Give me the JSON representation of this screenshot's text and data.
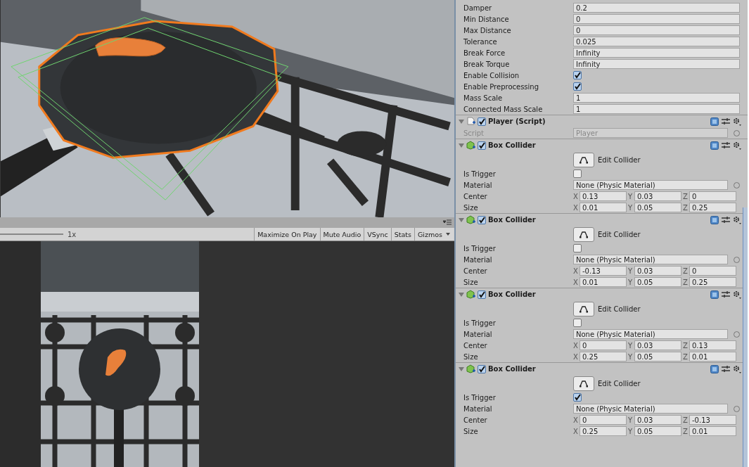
{
  "game_toolbar": {
    "scale_label": "1x",
    "buttons": [
      {
        "label": "Maximize On Play",
        "kind": "toggle"
      },
      {
        "label": "Mute Audio",
        "kind": "toggle"
      },
      {
        "label": "VSync",
        "kind": "toggle"
      },
      {
        "label": "Stats",
        "kind": "toggle"
      },
      {
        "label": "Gizmos",
        "kind": "dropdown"
      }
    ]
  },
  "inspector": {
    "joint_fields": [
      {
        "label": "Damper",
        "kind": "text",
        "value": "0.2"
      },
      {
        "label": "Min Distance",
        "kind": "text",
        "value": "0"
      },
      {
        "label": "Max Distance",
        "kind": "text",
        "value": "0"
      },
      {
        "label": "Tolerance",
        "kind": "text",
        "value": "0.025"
      },
      {
        "label": "Break Force",
        "kind": "text",
        "value": "Infinity"
      },
      {
        "label": "Break Torque",
        "kind": "text",
        "value": "Infinity"
      },
      {
        "label": "Enable Collision",
        "kind": "checkbox",
        "checked": true
      },
      {
        "label": "Enable Preprocessing",
        "kind": "checkbox",
        "checked": true
      },
      {
        "label": "Mass Scale",
        "kind": "text",
        "value": "1"
      },
      {
        "label": "Connected Mass Scale",
        "kind": "text",
        "value": "1"
      }
    ],
    "components": [
      {
        "kind": "script",
        "title": "Player (Script)",
        "enabled": true,
        "fields": [
          {
            "label": "Script",
            "kind": "object",
            "value": "Player",
            "disabled": true
          }
        ]
      },
      {
        "kind": "collider",
        "title": "Box Collider",
        "enabled": true,
        "button": "Edit Collider",
        "fields": [
          {
            "label": "Is Trigger",
            "kind": "checkbox",
            "checked": false
          },
          {
            "label": "Material",
            "kind": "object",
            "value": "None (Physic Material)",
            "disabled": false
          },
          {
            "label": "Center",
            "kind": "vector3",
            "axes": [
              {
                "axis": "X",
                "value": "0.13"
              },
              {
                "axis": "Y",
                "value": "0.03"
              },
              {
                "axis": "Z",
                "value": "0"
              }
            ]
          },
          {
            "label": "Size",
            "kind": "vector3",
            "axes": [
              {
                "axis": "X",
                "value": "0.01"
              },
              {
                "axis": "Y",
                "value": "0.05"
              },
              {
                "axis": "Z",
                "value": "0.25"
              }
            ]
          }
        ]
      },
      {
        "kind": "collider",
        "title": "Box Collider",
        "enabled": true,
        "button": "Edit Collider",
        "fields": [
          {
            "label": "Is Trigger",
            "kind": "checkbox",
            "checked": false
          },
          {
            "label": "Material",
            "kind": "object",
            "value": "None (Physic Material)",
            "disabled": false
          },
          {
            "label": "Center",
            "kind": "vector3",
            "axes": [
              {
                "axis": "X",
                "value": "-0.13"
              },
              {
                "axis": "Y",
                "value": "0.03"
              },
              {
                "axis": "Z",
                "value": "0"
              }
            ]
          },
          {
            "label": "Size",
            "kind": "vector3",
            "axes": [
              {
                "axis": "X",
                "value": "0.01"
              },
              {
                "axis": "Y",
                "value": "0.05"
              },
              {
                "axis": "Z",
                "value": "0.25"
              }
            ]
          }
        ]
      },
      {
        "kind": "collider",
        "title": "Box Collider",
        "enabled": true,
        "button": "Edit Collider",
        "fields": [
          {
            "label": "Is Trigger",
            "kind": "checkbox",
            "checked": false
          },
          {
            "label": "Material",
            "kind": "object",
            "value": "None (Physic Material)",
            "disabled": false
          },
          {
            "label": "Center",
            "kind": "vector3",
            "axes": [
              {
                "axis": "X",
                "value": "0"
              },
              {
                "axis": "Y",
                "value": "0.03"
              },
              {
                "axis": "Z",
                "value": "0.13"
              }
            ]
          },
          {
            "label": "Size",
            "kind": "vector3",
            "axes": [
              {
                "axis": "X",
                "value": "0.25"
              },
              {
                "axis": "Y",
                "value": "0.05"
              },
              {
                "axis": "Z",
                "value": "0.01"
              }
            ]
          }
        ]
      },
      {
        "kind": "collider",
        "title": "Box Collider",
        "enabled": true,
        "button": "Edit Collider",
        "fields": [
          {
            "label": "Is Trigger",
            "kind": "checkbox",
            "checked": true
          },
          {
            "label": "Material",
            "kind": "object",
            "value": "None (Physic Material)",
            "disabled": false
          },
          {
            "label": "Center",
            "kind": "vector3",
            "axes": [
              {
                "axis": "X",
                "value": "0"
              },
              {
                "axis": "Y",
                "value": "0.03"
              },
              {
                "axis": "Z",
                "value": "-0.13"
              }
            ]
          },
          {
            "label": "Size",
            "kind": "vector3",
            "axes": [
              {
                "axis": "X",
                "value": "0.25"
              },
              {
                "axis": "Y",
                "value": "0.05"
              },
              {
                "axis": "Z",
                "value": "0.01"
              }
            ]
          }
        ]
      }
    ]
  }
}
